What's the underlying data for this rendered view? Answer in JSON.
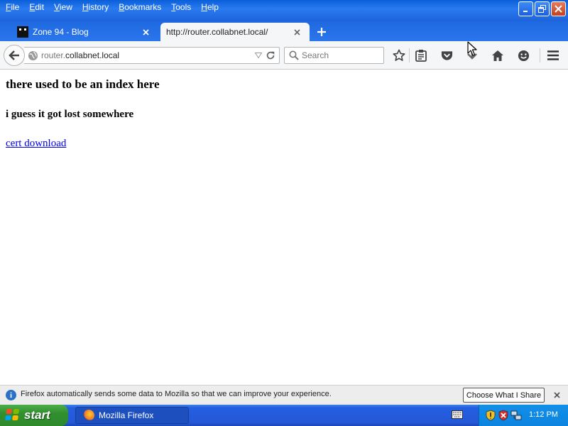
{
  "menu": {
    "items": [
      {
        "label": "File",
        "accel": "F",
        "rest": "ile"
      },
      {
        "label": "Edit",
        "accel": "E",
        "rest": "dit"
      },
      {
        "label": "View",
        "accel": "V",
        "rest": "iew"
      },
      {
        "label": "History",
        "accel": "H",
        "rest": "istory"
      },
      {
        "label": "Bookmarks",
        "accel": "B",
        "rest": "ookmarks"
      },
      {
        "label": "Tools",
        "accel": "T",
        "rest": "ools"
      },
      {
        "label": "Help",
        "accel": "H",
        "rest": "elp"
      }
    ]
  },
  "tabs": [
    {
      "title": "Zone 94 - Blog",
      "active": false
    },
    {
      "title": "http://router.collabnet.local/",
      "active": true
    }
  ],
  "urlbar": {
    "url_prefix": "router.",
    "url_host": "collabnet.local"
  },
  "search": {
    "placeholder": "Search"
  },
  "page": {
    "heading": "there used to be an index here",
    "subheading": "i guess it got lost somewhere",
    "link_text": "cert download"
  },
  "notification": {
    "message": "Firefox automatically sends some data to Mozilla so that we can improve your experience.",
    "button_label": "Choose What I Share",
    "info_glyph": "i"
  },
  "taskbar": {
    "start_label": "start",
    "task_label": "Mozilla Firefox",
    "clock": "1:12 PM"
  },
  "colors": {
    "xp_blue": "#1d63dc",
    "link": "#0000ee",
    "start_green": "#318f2e"
  }
}
